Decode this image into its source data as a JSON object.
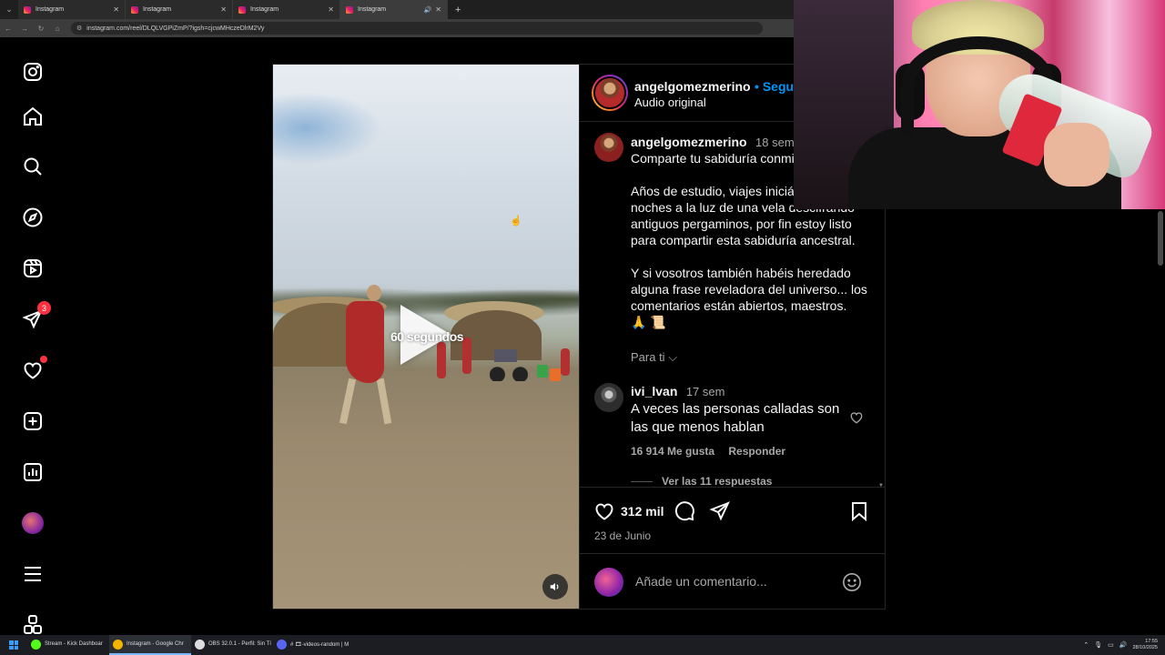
{
  "browser": {
    "tabs": [
      {
        "label": "Instagram",
        "active": false
      },
      {
        "label": "Instagram",
        "active": false
      },
      {
        "label": "Instagram",
        "active": false
      },
      {
        "label": "Instagram",
        "active": true
      }
    ],
    "url": "instagram.com/reel/DLQLVGPiZmP/?igsh=cjcwMHczeDlrM2Vy"
  },
  "sidebar": {
    "items": [
      {
        "name": "instagram-logo-icon"
      },
      {
        "name": "home-icon"
      },
      {
        "name": "search-icon"
      },
      {
        "name": "explore-icon"
      },
      {
        "name": "reels-icon"
      },
      {
        "name": "messages-icon",
        "badge": "3"
      },
      {
        "name": "notifications-icon"
      },
      {
        "name": "create-icon"
      },
      {
        "name": "dashboard-icon"
      },
      {
        "name": "profile-avatar"
      },
      {
        "name": "more-menu-icon"
      },
      {
        "name": "threads-icon"
      }
    ]
  },
  "video": {
    "overlay_text": "60 segundos"
  },
  "post": {
    "username": "angelgomezmerino",
    "follow_label": "• Seguir",
    "audio": "Audio original",
    "caption": {
      "username": "angelgomezmerino",
      "time": "18 sem",
      "text": "Comparte tu sabiduría conmigo\n\nAños de estudio, viajes iniciáticos y noches a la luz de una vela descifrando antiguos pergaminos, por fin estoy listo para compartir esta sabiduría ancestral.\n\nY si vosotros también habéis heredado alguna frase reveladora del universo... los comentarios están abiertos, maestros.\n🙏 📜"
    },
    "para_ti": "Para ti",
    "comment": {
      "username": "ivi_lvan",
      "time": "17 sem",
      "text": "A veces las personas calladas son las que menos hablan",
      "likes": "16 914 Me gusta",
      "reply": "Responder",
      "see_replies": "Ver las 11 respuestas"
    },
    "likes": "312 mil",
    "date": "23 de Junio",
    "add_comment_placeholder": "Añade un comentario..."
  },
  "taskbar": {
    "items": [
      {
        "label": "Stream - Kick Dashboar",
        "color": "#53fc18"
      },
      {
        "label": "Instagram - Google Chr",
        "color": "#f4b400",
        "active": true
      },
      {
        "label": "OBS 32.0.1 - Perfil: Sin Tí",
        "color": "#dddddd"
      },
      {
        "label": "# 🎞-videos-random | M",
        "color": "#5865f2"
      }
    ],
    "time": "17:55",
    "date": "28/10/2025"
  },
  "colors": {
    "accent": "#0095f6",
    "badge": "#ff3040",
    "background": "#000000"
  }
}
